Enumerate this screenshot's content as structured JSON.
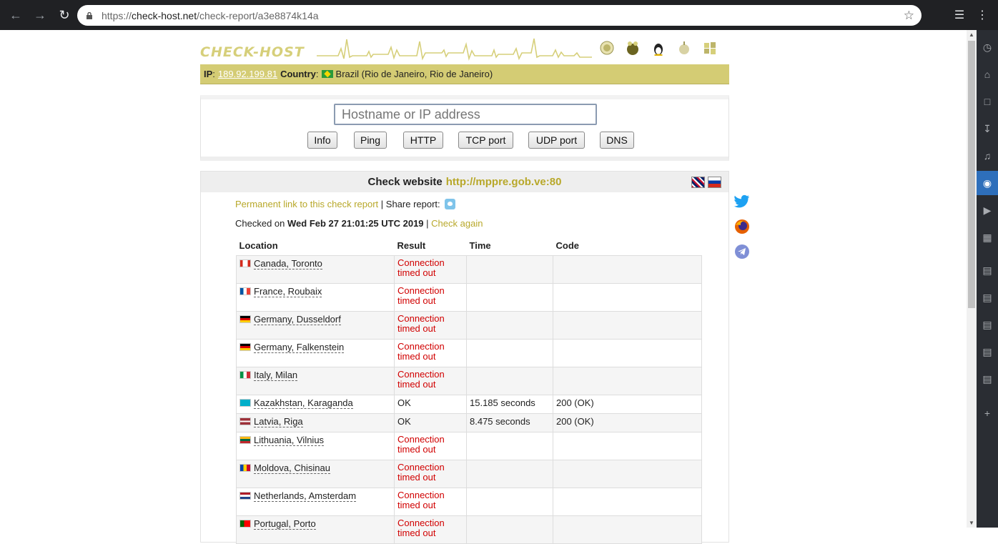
{
  "browser": {
    "url_scheme": "https://",
    "url_host": "check-host.net",
    "url_path": "/check-report/a3e8874k14a"
  },
  "site": {
    "logo": "CHECK-HOST",
    "ip_label": "IP",
    "ip": "189.92.199.81",
    "country_label": "Country",
    "country": "Brazil (Rio de Janeiro, Rio de Janeiro)"
  },
  "search": {
    "placeholder": "Hostname or IP address",
    "buttons": [
      "Info",
      "Ping",
      "HTTP",
      "TCP port",
      "UDP port",
      "DNS"
    ]
  },
  "report": {
    "title": "Check website",
    "target": "http://mppre.gob.ve:80",
    "permalink": "Permanent link to this check report",
    "share_label": "| Share report:",
    "checked_prefix": "Checked on",
    "checked_date": "Wed Feb 27 21:01:25 UTC 2019",
    "separator": "|",
    "check_again": "Check again"
  },
  "table": {
    "headers": [
      "Location",
      "Result",
      "Time",
      "Code"
    ],
    "rows": [
      {
        "location": "Canada, Toronto",
        "flag": "ca",
        "result": "Connection timed out",
        "time": "",
        "code": ""
      },
      {
        "location": "France, Roubaix",
        "flag": "fr",
        "result": "Connection timed out",
        "time": "",
        "code": ""
      },
      {
        "location": "Germany, Dusseldorf",
        "flag": "de",
        "result": "Connection timed out",
        "time": "",
        "code": ""
      },
      {
        "location": "Germany, Falkenstein",
        "flag": "de",
        "result": "Connection timed out",
        "time": "",
        "code": ""
      },
      {
        "location": "Italy, Milan",
        "flag": "it",
        "result": "Connection timed out",
        "time": "",
        "code": ""
      },
      {
        "location": "Kazakhstan, Karaganda",
        "flag": "kz",
        "result": "OK",
        "time": "15.185 seconds",
        "code": "200 (OK)"
      },
      {
        "location": "Latvia, Riga",
        "flag": "lv",
        "result": "OK",
        "time": "8.475 seconds",
        "code": "200 (OK)"
      },
      {
        "location": "Lithuania, Vilnius",
        "flag": "lt",
        "result": "Connection timed out",
        "time": "",
        "code": ""
      },
      {
        "location": "Moldova, Chisinau",
        "flag": "md",
        "result": "Connection timed out",
        "time": "",
        "code": ""
      },
      {
        "location": "Netherlands, Amsterdam",
        "flag": "nl",
        "result": "Connection timed out",
        "time": "",
        "code": ""
      },
      {
        "location": "Portugal, Porto",
        "flag": "pt",
        "result": "Connection timed out",
        "time": "",
        "code": ""
      }
    ]
  },
  "colors": {
    "accent": "#b8a82a",
    "ipbar": "#d4cc74",
    "error": "#d10000"
  }
}
